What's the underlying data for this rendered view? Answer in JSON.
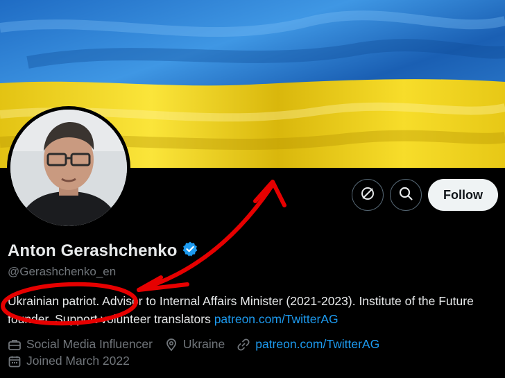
{
  "profile": {
    "display_name": "Anton Gerashchenko",
    "handle": "@Gerashchenko_en",
    "verified": true,
    "bio_text": "Ukrainian patriot. Advisor to Internal Affairs Minister (2021-2023). Institute of the Future founder. Support volunteer translators ",
    "bio_link": "patreon.com/TwitterAG",
    "category": "Social Media Influencer",
    "location": "Ukraine",
    "website": "patreon.com/TwitterAG",
    "joined": "Joined March 2022"
  },
  "actions": {
    "follow_label": "Follow",
    "more_icon": "grok-icon",
    "search_icon": "search-icon"
  },
  "banner": {
    "description_colors": {
      "blue": "#2f7fd0",
      "yellow": "#f2d31a"
    }
  },
  "colors": {
    "link": "#1d9bf0",
    "verified_badge": "#1d9bf0",
    "annotation": "#e60000"
  }
}
